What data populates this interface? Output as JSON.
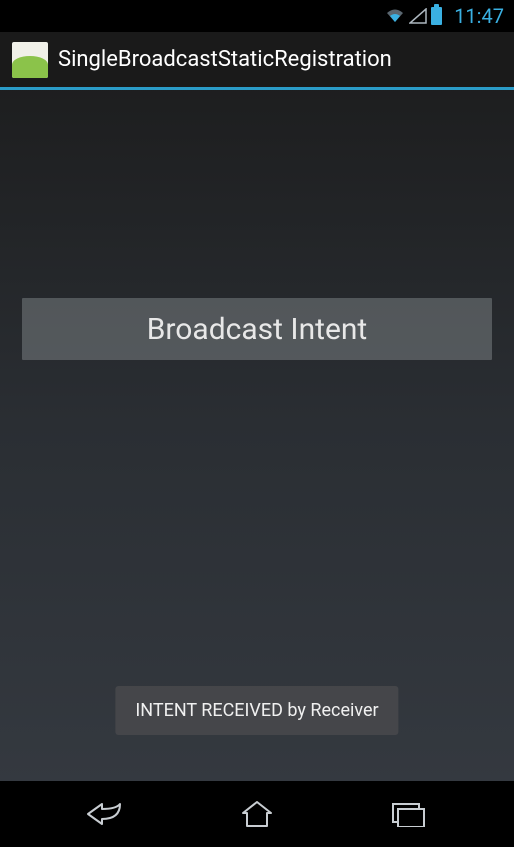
{
  "status_bar": {
    "time": "11:47"
  },
  "action_bar": {
    "title": "SingleBroadcastStaticRegistration"
  },
  "main": {
    "button_label": "Broadcast Intent"
  },
  "toast": {
    "message": "INTENT RECEIVED by Receiver"
  }
}
